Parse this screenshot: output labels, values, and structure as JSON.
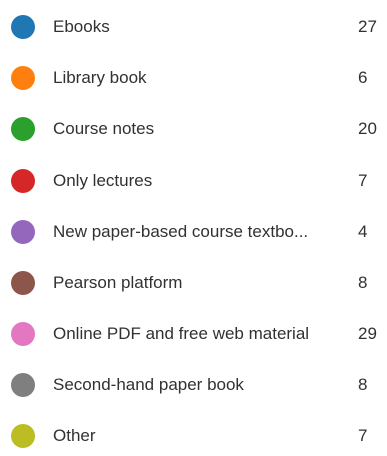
{
  "legend": {
    "items": [
      {
        "label": "Ebooks",
        "count": "27",
        "color": "#1f77b4"
      },
      {
        "label": "Library book",
        "count": "6",
        "color": "#ff7f0e"
      },
      {
        "label": "Course notes",
        "count": "20",
        "color": "#2ca02c"
      },
      {
        "label": "Only lectures",
        "count": "7",
        "color": "#d62728"
      },
      {
        "label": "New paper-based course textbo...",
        "count": "4",
        "color": "#9467bd"
      },
      {
        "label": "Pearson platform",
        "count": "8",
        "color": "#8c564b"
      },
      {
        "label": "Online PDF and free web material",
        "count": "29",
        "color": "#e377c2"
      },
      {
        "label": "Second-hand paper book",
        "count": "8",
        "color": "#7f7f7f"
      },
      {
        "label": "Other",
        "count": "7",
        "color": "#bcbd22"
      }
    ]
  }
}
